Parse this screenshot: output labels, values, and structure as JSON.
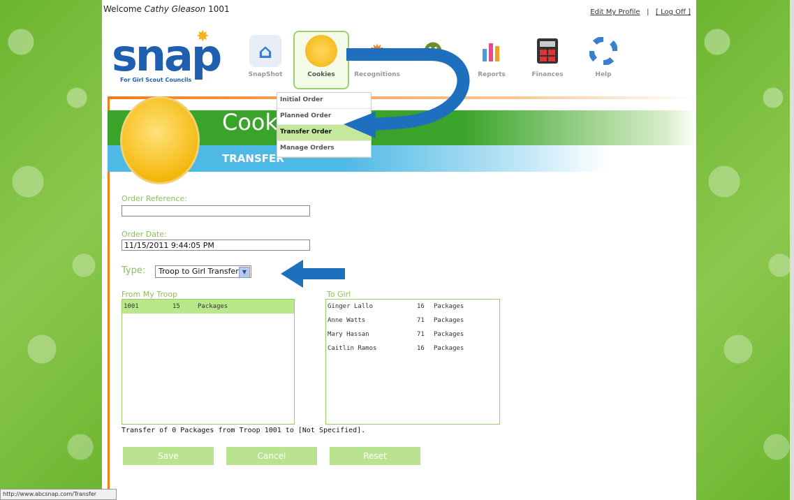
{
  "header": {
    "welcome_prefix": "Welcome",
    "user_name": "Cathy Gleason",
    "troop_number": "1001",
    "edit_profile": "Edit My Profile",
    "separator": "|",
    "log_off": "[ Log Off ]"
  },
  "logo": {
    "word": "snap",
    "tagline": "For Girl Scout Councils"
  },
  "nav": {
    "items": [
      {
        "label": "SnapShot",
        "icon": "house-icon"
      },
      {
        "label": "Cookies",
        "icon": "cookie-icon"
      },
      {
        "label": "Recognitions",
        "icon": "badge-icon"
      },
      {
        "label": "",
        "icon": "people-icon"
      },
      {
        "label": "Reports",
        "icon": "bar-chart-icon"
      },
      {
        "label": "Finances",
        "icon": "calculator-icon"
      },
      {
        "label": "Help",
        "icon": "lifebuoy-icon"
      }
    ]
  },
  "cookies_menu": {
    "items": [
      "Initial Order",
      "Planned Order",
      "Transfer Order",
      "Manage Orders"
    ],
    "selected": "Transfer Order"
  },
  "banner": {
    "title": "Cooki",
    "subtitle": "TRANSFER"
  },
  "form": {
    "order_reference_label": "Order Reference:",
    "order_reference_value": "",
    "order_date_label": "Order Date:",
    "order_date_value": "11/15/2011 9:44:05 PM",
    "type_label": "Type:",
    "type_value": "Troop to Girl Transfer"
  },
  "from_troop": {
    "label": "From My Troop",
    "rows": [
      {
        "id": "1001",
        "qty": "15",
        "unit": "Packages"
      }
    ]
  },
  "to_girl": {
    "label": "To Girl",
    "rows": [
      {
        "name": "Ginger Lallo",
        "qty": "16",
        "unit": "Packages"
      },
      {
        "name": "Anne Watts",
        "qty": "71",
        "unit": "Packages"
      },
      {
        "name": "Mary Hassan",
        "qty": "71",
        "unit": "Packages"
      },
      {
        "name": "Caitlin Ramos",
        "qty": "16",
        "unit": "Packages"
      }
    ]
  },
  "status_text": "Transfer of 0 Packages from Troop 1001 to [Not Specified].",
  "buttons": {
    "save": "Save",
    "cancel": "Cancel",
    "reset": "Reset"
  },
  "browser_status": "http://www.abcsnap.com/Transfer",
  "colors": {
    "green": "#3aa42a",
    "light_green": "#b9e38f",
    "blue": "#4fb9e6",
    "orange": "#f07d17",
    "arrow_blue": "#1f6fbf"
  }
}
